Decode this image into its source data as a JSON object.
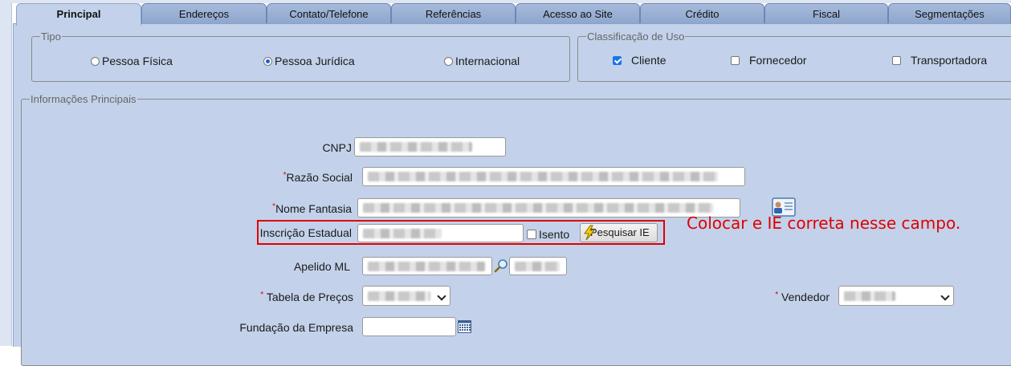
{
  "tabs": [
    "Principal",
    "Endereços",
    "Contato/Telefone",
    "Referências",
    "Acesso ao Site",
    "Crédito",
    "Fiscal",
    "Segmentações"
  ],
  "tipo": {
    "legend": "Tipo",
    "options": [
      {
        "label": "Pessoa Física",
        "checked": false
      },
      {
        "label": "Pessoa Jurídica",
        "checked": true
      },
      {
        "label": "Internacional",
        "checked": false
      }
    ]
  },
  "classificacao": {
    "legend": "Classificação de Uso",
    "options": [
      {
        "label": "Cliente",
        "checked": true
      },
      {
        "label": "Fornecedor",
        "checked": false
      },
      {
        "label": "Transportadora",
        "checked": false
      }
    ]
  },
  "info": {
    "legend": "Informações Principais",
    "cnpj_label": "CNPJ",
    "razao_label": "Razão Social",
    "fantasia_label": "Nome Fantasia",
    "ie_label": "Inscrição Estadual",
    "isento_label": "Isento",
    "pesquisar_ie_label": "Pesquisar IE",
    "apelido_label": "Apelido ML",
    "tabela_label": "Tabela de Preços",
    "vendedor_label": "Vendedor",
    "fundacao_label": "Fundação da Empresa",
    "fundacao_value": "",
    "required_mark": "*"
  },
  "annotation": "Colocar e IE correta nesse campo.",
  "icons": {
    "contact_card": "contact-card-icon",
    "search": "magnifier-icon",
    "calendar": "calendar-icon",
    "lightning": "lightning-icon"
  },
  "colors": {
    "panel": "#c3d2ea",
    "tab": "#9fb4d6",
    "annotation": "#e00000",
    "checkbox_on": "#1a73e8"
  }
}
